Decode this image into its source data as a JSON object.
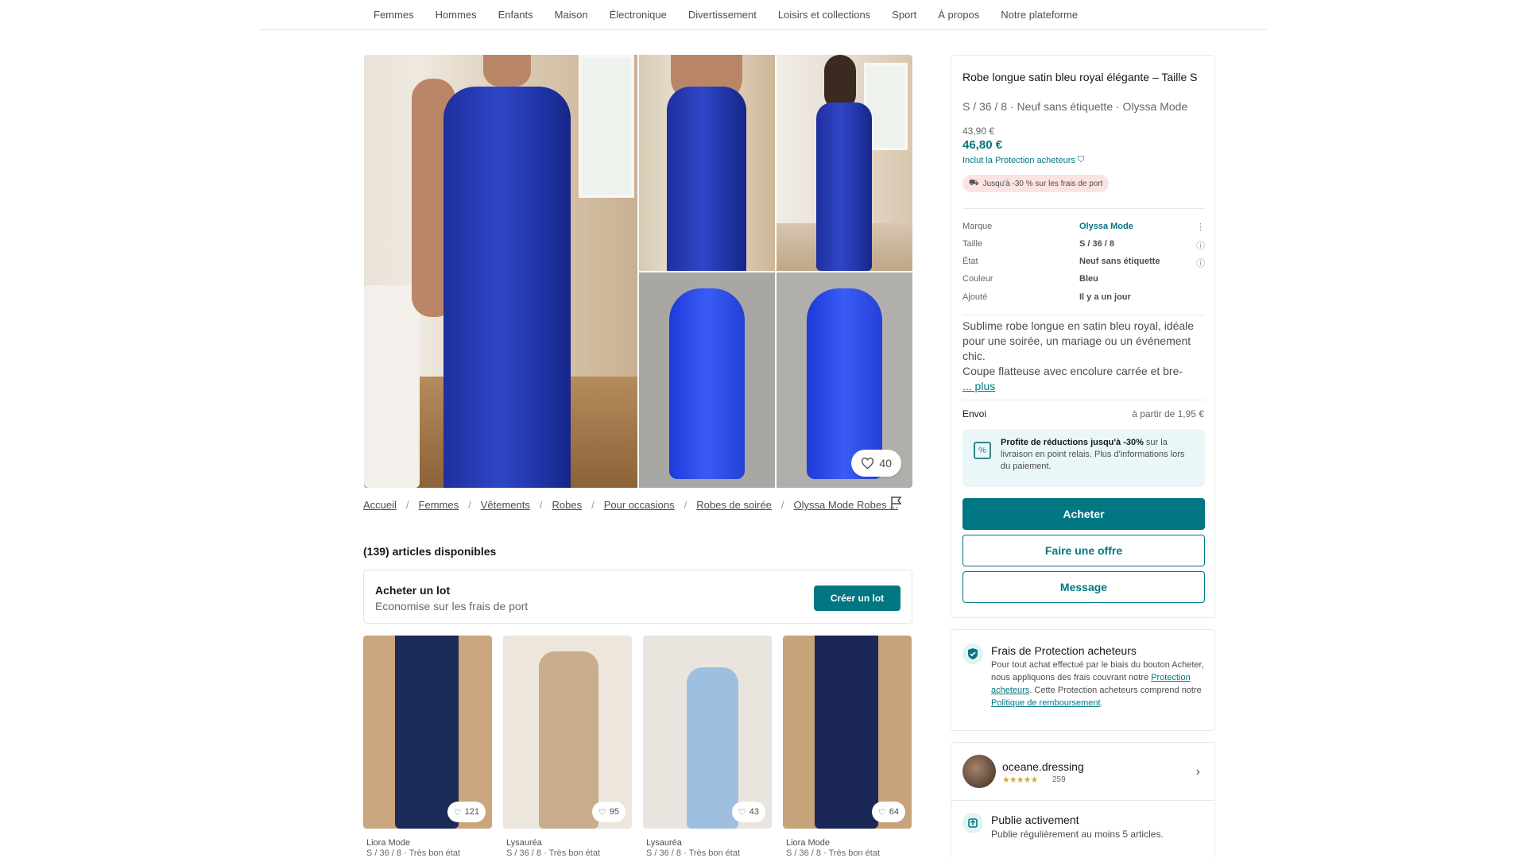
{
  "nav": {
    "items": [
      "Femmes",
      "Hommes",
      "Enfants",
      "Maison",
      "Électronique",
      "Divertissement",
      "Loisirs et collections",
      "Sport",
      "À propos",
      "Notre plateforme"
    ]
  },
  "gallery": {
    "favorites_count": "40"
  },
  "breadcrumb": {
    "items": [
      "Accueil",
      "Femmes",
      "Vêtements",
      "Robes",
      "Pour occasions",
      "Robes de soirée",
      "Olyssa Mode Robes ..."
    ]
  },
  "available": "(139) articles disponibles",
  "lot": {
    "title": "Acheter un lot",
    "subtitle": "Economise sur les frais de port",
    "button": "Créer un lot"
  },
  "similar": [
    {
      "seller": "Liora Mode",
      "meta": "S / 36 / 8 · Très bon état",
      "favorites": "121",
      "dress_color": "#1c2a57",
      "bg": "#c9a67d"
    },
    {
      "seller": "Lysauréa",
      "meta": "S / 36 / 8 · Très bon état",
      "favorites": "95",
      "dress_color": "#c8ac8c",
      "bg": "#ece6dc"
    },
    {
      "seller": "Lysauréa",
      "meta": "S / 36 / 8 · Très bon état",
      "favorites": "43",
      "dress_color": "#9fbfe0",
      "bg": "#e9e5de"
    },
    {
      "seller": "Liora Mode",
      "meta": "S / 36 / 8 · Très bon état",
      "favorites": "64",
      "dress_color": "#1a2756",
      "bg": "#c7a37a"
    }
  ],
  "item": {
    "title": "Robe longue satin bleu royal élégante – Taille S",
    "subtitle": "S / 36 / 8 · Neuf sans étiquette · Olyssa Mode",
    "old_price": "43,90 €",
    "price": "46,80 €",
    "protection_included": "Inclut la Protection acheteurs",
    "shipping_badge": "Jusqu'à -30 % sur les frais de port",
    "attributes": [
      {
        "key": "Marque",
        "value": "Olyssa Mode",
        "link": true,
        "icon": "more-icon"
      },
      {
        "key": "Taille",
        "value": "S / 36 / 8",
        "link": false,
        "icon": "info-icon"
      },
      {
        "key": "État",
        "value": "Neuf sans étiquette",
        "link": false,
        "icon": "info-icon"
      },
      {
        "key": "Couleur",
        "value": "Bleu",
        "link": false,
        "icon": ""
      },
      {
        "key": "Ajouté",
        "value": "Il y a un jour",
        "link": false,
        "icon": ""
      }
    ],
    "description": "Sublime robe longue en satin bleu royal, idéale pour une soirée, un mariage ou un événement chic.\nCoupe flatteuse avec encolure carrée et bre-",
    "more": "... plus",
    "shipping_label": "Envoi",
    "shipping_value": "à partir de 1,95 €",
    "promo_bold": "Profite de réductions jusqu'à -30%",
    "promo_rest": " sur la livraison en point relais. Plus d'informations lors du paiement.",
    "buy": "Acheter",
    "offer": "Faire une offre",
    "message": "Message"
  },
  "protection": {
    "title": "Frais de Protection acheteurs",
    "text_1": "Pour tout achat effectué par le biais du bouton Acheter, nous appliquons des frais couvrant notre ",
    "link_1": "Protection acheteurs",
    "text_2": ". Cette Protection acheteurs comprend notre ",
    "link_2": "Politique de remboursement",
    "text_3": "."
  },
  "seller": {
    "name": "oceane.dressing",
    "stars": "★★★★★",
    "reviews": "259",
    "badge_title": "Publie activement",
    "badge_text": "Publie régulièrement au moins 5 articles."
  },
  "colors": {
    "accent": "#007782",
    "dress": "#2a3fc0"
  }
}
